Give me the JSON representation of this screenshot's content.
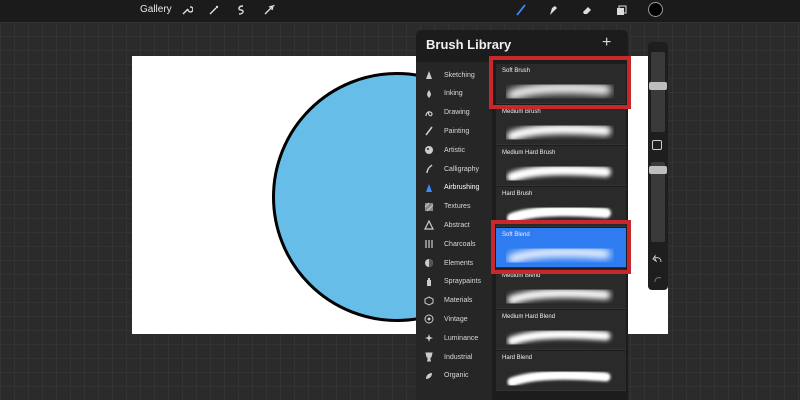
{
  "toolbar": {
    "gallery_label": "Gallery",
    "left_icons": [
      "wrench-icon",
      "magic-wand-icon",
      "selection-icon",
      "transform-arrow-icon"
    ],
    "right_icons": [
      "brush-icon",
      "smudge-icon",
      "eraser-icon",
      "layers-icon"
    ],
    "current_color": "#000000"
  },
  "canvas": {
    "circle_color": "#66bde8",
    "circle_stroke": "#000000"
  },
  "library": {
    "title": "Brush Library",
    "add_label": "+",
    "sets": [
      {
        "label": "Sketching",
        "icon": "pencil-icon"
      },
      {
        "label": "Inking",
        "icon": "ink-drop-icon"
      },
      {
        "label": "Drawing",
        "icon": "squiggle-icon"
      },
      {
        "label": "Painting",
        "icon": "paint-brush-icon"
      },
      {
        "label": "Artistic",
        "icon": "palette-icon"
      },
      {
        "label": "Calligraphy",
        "icon": "calligraphy-icon"
      },
      {
        "label": "Airbrushing",
        "icon": "airbrush-icon",
        "active": true
      },
      {
        "label": "Textures",
        "icon": "texture-icon"
      },
      {
        "label": "Abstract",
        "icon": "triangle-icon"
      },
      {
        "label": "Charcoals",
        "icon": "charcoal-icon"
      },
      {
        "label": "Elements",
        "icon": "yin-yang-icon"
      },
      {
        "label": "Spraypaints",
        "icon": "spray-can-icon"
      },
      {
        "label": "Materials",
        "icon": "cube-icon"
      },
      {
        "label": "Vintage",
        "icon": "star-badge-icon"
      },
      {
        "label": "Luminance",
        "icon": "sparkle-icon"
      },
      {
        "label": "Industrial",
        "icon": "trophy-icon"
      },
      {
        "label": "Organic",
        "icon": "leaf-icon"
      }
    ],
    "brushes": [
      {
        "name": "Soft Brush"
      },
      {
        "name": "Medium Brush"
      },
      {
        "name": "Medium Hard Brush"
      },
      {
        "name": "Hard Brush"
      },
      {
        "name": "Soft Blend",
        "selected": true
      },
      {
        "name": "Medium Blend"
      },
      {
        "name": "Medium Hard Blend"
      },
      {
        "name": "Hard Blend"
      }
    ],
    "selected_color": "#2f7bf0",
    "highlight_color": "#c8282b"
  }
}
